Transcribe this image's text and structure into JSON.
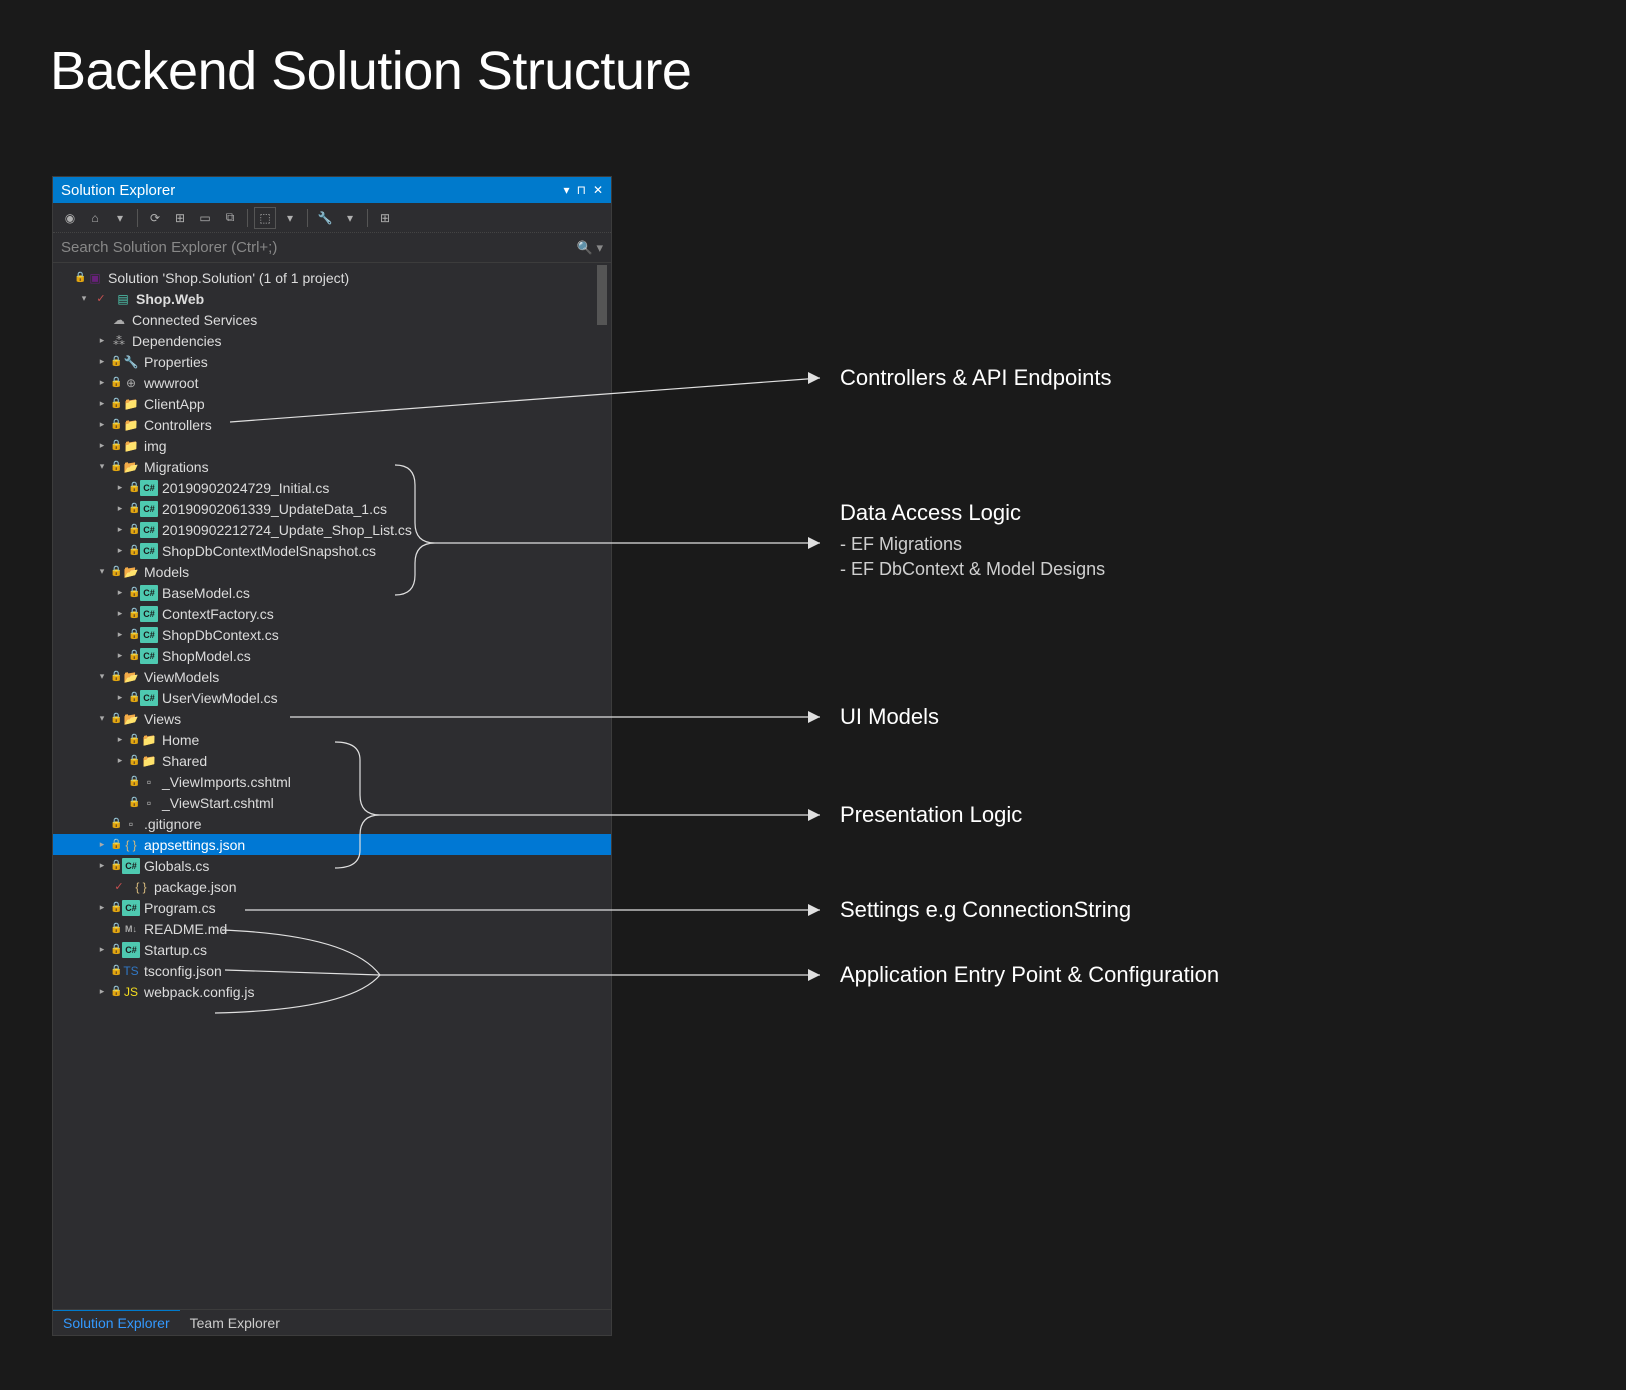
{
  "page_title": "Backend Solution Structure",
  "panel": {
    "title": "Solution Explorer",
    "controls": {
      "menu": "▾",
      "pin": "📌",
      "close": "✕"
    }
  },
  "search": {
    "placeholder": "Search Solution Explorer (Ctrl+;)"
  },
  "tree": [
    {
      "indent": 0,
      "expander": "",
      "icons": [
        "lock",
        "sln"
      ],
      "label": "Solution 'Shop.Solution' (1 of 1 project)",
      "bold": false,
      "selected": false
    },
    {
      "indent": 1,
      "expander": "▾",
      "icons": [
        "check",
        "proj"
      ],
      "label": "Shop.Web",
      "bold": true,
      "selected": false
    },
    {
      "indent": 2,
      "expander": "",
      "icons": [
        "cloud"
      ],
      "label": "Connected Services",
      "bold": false,
      "selected": false
    },
    {
      "indent": 2,
      "expander": "▸",
      "icons": [
        "dep"
      ],
      "label": "Dependencies",
      "bold": false,
      "selected": false
    },
    {
      "indent": 2,
      "expander": "▸",
      "icons": [
        "lock",
        "wrench"
      ],
      "label": "Properties",
      "bold": false,
      "selected": false
    },
    {
      "indent": 2,
      "expander": "▸",
      "icons": [
        "lock",
        "globe"
      ],
      "label": "wwwroot",
      "bold": false,
      "selected": false
    },
    {
      "indent": 2,
      "expander": "▸",
      "icons": [
        "lock",
        "folder"
      ],
      "label": "ClientApp",
      "bold": false,
      "selected": false
    },
    {
      "indent": 2,
      "expander": "▸",
      "icons": [
        "lock",
        "folder"
      ],
      "label": "Controllers",
      "bold": false,
      "selected": false
    },
    {
      "indent": 2,
      "expander": "▸",
      "icons": [
        "lock",
        "folder"
      ],
      "label": "img",
      "bold": false,
      "selected": false
    },
    {
      "indent": 2,
      "expander": "▾",
      "icons": [
        "lock",
        "folder-open"
      ],
      "label": "Migrations",
      "bold": false,
      "selected": false
    },
    {
      "indent": 3,
      "expander": "▸",
      "icons": [
        "lock",
        "cs"
      ],
      "label": "20190902024729_Initial.cs",
      "bold": false,
      "selected": false
    },
    {
      "indent": 3,
      "expander": "▸",
      "icons": [
        "lock",
        "cs"
      ],
      "label": "20190902061339_UpdateData_1.cs",
      "bold": false,
      "selected": false
    },
    {
      "indent": 3,
      "expander": "▸",
      "icons": [
        "lock",
        "cs"
      ],
      "label": "20190902212724_Update_Shop_List.cs",
      "bold": false,
      "selected": false
    },
    {
      "indent": 3,
      "expander": "▸",
      "icons": [
        "lock",
        "cs"
      ],
      "label": "ShopDbContextModelSnapshot.cs",
      "bold": false,
      "selected": false
    },
    {
      "indent": 2,
      "expander": "▾",
      "icons": [
        "lock",
        "folder-open"
      ],
      "label": "Models",
      "bold": false,
      "selected": false
    },
    {
      "indent": 3,
      "expander": "▸",
      "icons": [
        "lock",
        "cs"
      ],
      "label": "BaseModel.cs",
      "bold": false,
      "selected": false
    },
    {
      "indent": 3,
      "expander": "▸",
      "icons": [
        "lock",
        "cs"
      ],
      "label": "ContextFactory.cs",
      "bold": false,
      "selected": false
    },
    {
      "indent": 3,
      "expander": "▸",
      "icons": [
        "lock",
        "cs"
      ],
      "label": "ShopDbContext.cs",
      "bold": false,
      "selected": false
    },
    {
      "indent": 3,
      "expander": "▸",
      "icons": [
        "lock",
        "cs"
      ],
      "label": "ShopModel.cs",
      "bold": false,
      "selected": false
    },
    {
      "indent": 2,
      "expander": "▾",
      "icons": [
        "lock",
        "folder-open"
      ],
      "label": "ViewModels",
      "bold": false,
      "selected": false
    },
    {
      "indent": 3,
      "expander": "▸",
      "icons": [
        "lock",
        "cs"
      ],
      "label": "UserViewModel.cs",
      "bold": false,
      "selected": false
    },
    {
      "indent": 2,
      "expander": "▾",
      "icons": [
        "lock",
        "folder-open"
      ],
      "label": "Views",
      "bold": false,
      "selected": false
    },
    {
      "indent": 3,
      "expander": "▸",
      "icons": [
        "lock",
        "folder"
      ],
      "label": "Home",
      "bold": false,
      "selected": false
    },
    {
      "indent": 3,
      "expander": "▸",
      "icons": [
        "lock",
        "folder"
      ],
      "label": "Shared",
      "bold": false,
      "selected": false
    },
    {
      "indent": 3,
      "expander": "",
      "icons": [
        "lock",
        "file"
      ],
      "label": "_ViewImports.cshtml",
      "bold": false,
      "selected": false
    },
    {
      "indent": 3,
      "expander": "",
      "icons": [
        "lock",
        "file"
      ],
      "label": "_ViewStart.cshtml",
      "bold": false,
      "selected": false
    },
    {
      "indent": 2,
      "expander": "",
      "icons": [
        "lock",
        "file"
      ],
      "label": ".gitignore",
      "bold": false,
      "selected": false
    },
    {
      "indent": 2,
      "expander": "▸",
      "icons": [
        "lock",
        "json"
      ],
      "label": "appsettings.json",
      "bold": false,
      "selected": true
    },
    {
      "indent": 2,
      "expander": "▸",
      "icons": [
        "lock",
        "cs"
      ],
      "label": "Globals.cs",
      "bold": false,
      "selected": false
    },
    {
      "indent": 2,
      "expander": "",
      "icons": [
        "check",
        "json"
      ],
      "label": "package.json",
      "bold": false,
      "selected": false
    },
    {
      "indent": 2,
      "expander": "▸",
      "icons": [
        "lock",
        "cs"
      ],
      "label": "Program.cs",
      "bold": false,
      "selected": false
    },
    {
      "indent": 2,
      "expander": "",
      "icons": [
        "lock",
        "md"
      ],
      "label": "README.md",
      "bold": false,
      "selected": false
    },
    {
      "indent": 2,
      "expander": "▸",
      "icons": [
        "lock",
        "cs"
      ],
      "label": "Startup.cs",
      "bold": false,
      "selected": false
    },
    {
      "indent": 2,
      "expander": "",
      "icons": [
        "lock",
        "ts"
      ],
      "label": "tsconfig.json",
      "bold": false,
      "selected": false
    },
    {
      "indent": 2,
      "expander": "▸",
      "icons": [
        "lock",
        "js"
      ],
      "label": "webpack.config.js",
      "bold": false,
      "selected": false
    }
  ],
  "bottom_tabs": {
    "active": "Solution Explorer",
    "inactive": "Team Explorer"
  },
  "annotations": [
    {
      "id": "controllers",
      "title": "Controllers & API Endpoints"
    },
    {
      "id": "data-access",
      "title": "Data Access Logic",
      "subs": [
        "- EF Migrations",
        "- EF DbContext & Model Designs"
      ]
    },
    {
      "id": "ui-models",
      "title": "UI Models"
    },
    {
      "id": "presentation",
      "title": "Presentation Logic"
    },
    {
      "id": "settings",
      "title": "Settings e.g ConnectionString"
    },
    {
      "id": "entry",
      "title": "Application Entry Point & Configuration"
    }
  ]
}
